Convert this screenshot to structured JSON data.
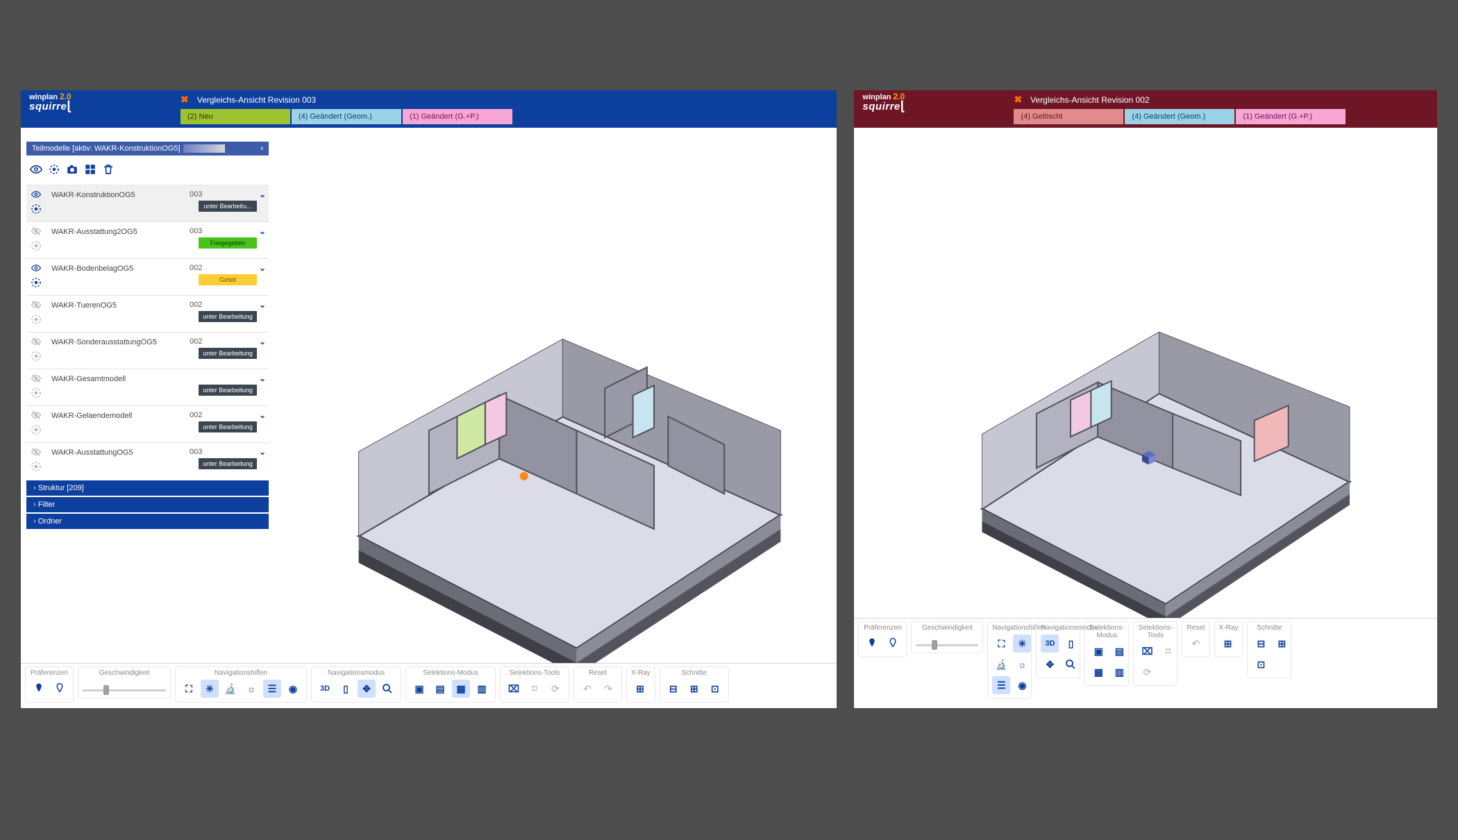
{
  "brand": {
    "name": "winplan",
    "version": "2.0",
    "product": "squirre"
  },
  "leftPanel": {
    "title": "Vergleichs-Ansicht Revision 003",
    "chips": [
      {
        "label": "(2) Neu",
        "cls": "neu"
      },
      {
        "label": "(4) Geändert (Geom.)",
        "cls": "geom"
      },
      {
        "label": "(1) Geändert (G.+P.)",
        "cls": "gp"
      }
    ],
    "sidebar": {
      "header": "Teilmodelle [aktiv: WAKR-KonstruktionOG5]",
      "models": [
        {
          "name": "WAKR-KonstruktionOG5",
          "rev": "003",
          "status": "unter Bearbeitu...",
          "statusCls": "b-dark",
          "visible": true
        },
        {
          "name": "WAKR-Ausstattung2OG5",
          "rev": "003",
          "status": "Freigegeben",
          "statusCls": "b-green",
          "visible": false
        },
        {
          "name": "WAKR-BodenbelagOG5",
          "rev": "002",
          "status": "Geteit",
          "statusCls": "b-yel",
          "visible": true
        },
        {
          "name": "WAKR-TuerenOG5",
          "rev": "002",
          "status": "unter Bearbeitung",
          "statusCls": "b-dark",
          "visible": false
        },
        {
          "name": "WAKR-SonderausstattungOG5",
          "rev": "002",
          "status": "unter Bearbeitung",
          "statusCls": "b-dark",
          "visible": false
        },
        {
          "name": "WAKR-Gesamtmodell",
          "rev": "",
          "status": "unter Bearbeitung",
          "statusCls": "b-dark",
          "visible": false
        },
        {
          "name": "WAKR-Gelaendemodell",
          "rev": "002",
          "status": "unter Bearbeitung",
          "statusCls": "b-dark",
          "visible": false
        },
        {
          "name": "WAKR-AusstattungOG5",
          "rev": "003",
          "status": "unter Bearbeitung",
          "statusCls": "b-dark",
          "visible": false
        }
      ],
      "sections": [
        "Struktur [209]",
        "Filter",
        "Ordner"
      ]
    }
  },
  "rightPanel": {
    "title": "Vergleichs-Ansicht Revision 002",
    "chips": [
      {
        "label": "(4) Gelöscht",
        "cls": "del"
      },
      {
        "label": "(4) Geändert (Geom.)",
        "cls": "geom"
      },
      {
        "label": "(1) Geändert (G.+P.)",
        "cls": "gp"
      }
    ]
  },
  "toolbarGroups": {
    "preferenzen": "Präferenzen",
    "geschwindigkeit": "Geschwindigkeit",
    "navhilfen": "Navigationshilfen",
    "navmodus": "Navigationsmodus",
    "selmodus": "Selektions-Modus",
    "seltools": "Selektions-Tools",
    "reset": "Reset",
    "xray": "X-Ray",
    "schnitte": "Schnitte"
  }
}
